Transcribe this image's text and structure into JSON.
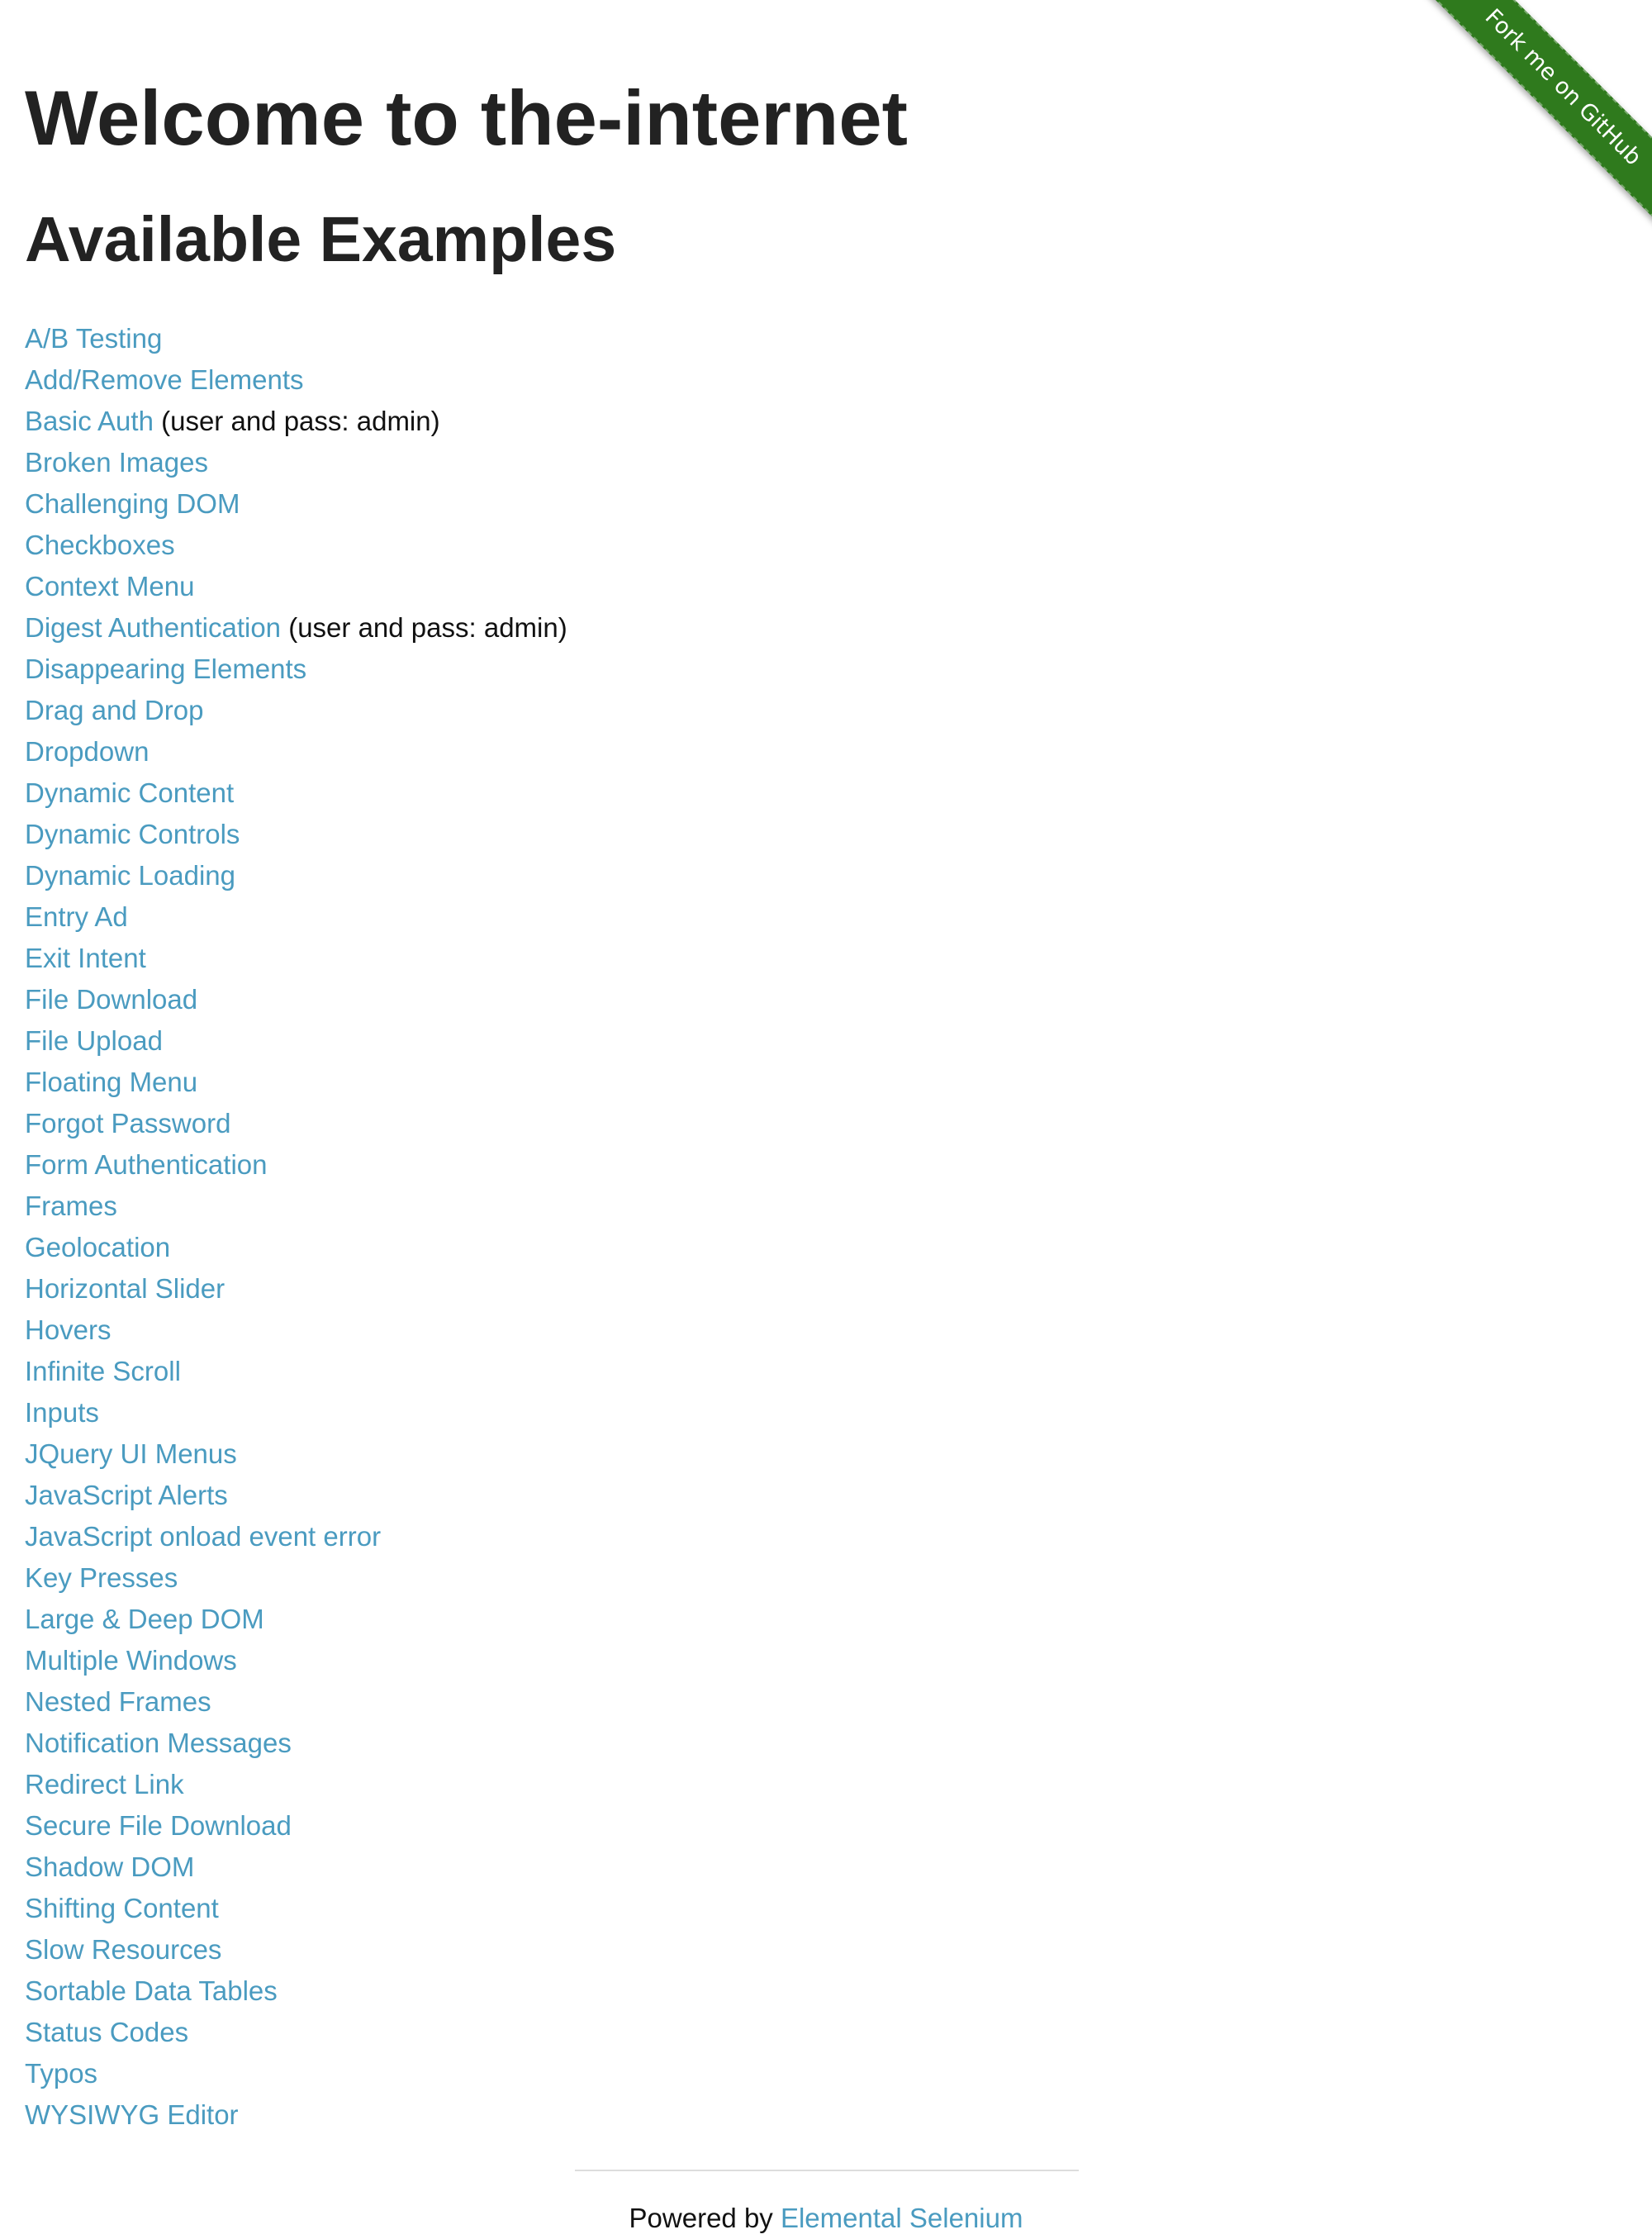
{
  "header": {
    "title": "Welcome to the-internet",
    "subtitle": "Available Examples"
  },
  "ribbon": {
    "label": "Fork me on GitHub",
    "color": "#2f7a1d"
  },
  "colors": {
    "link": "#4a9bc0",
    "heading": "#222222"
  },
  "examples": [
    {
      "label": "A/B Testing"
    },
    {
      "label": "Add/Remove Elements"
    },
    {
      "label": "Basic Auth",
      "note": "(user and pass: admin)"
    },
    {
      "label": "Broken Images"
    },
    {
      "label": "Challenging DOM"
    },
    {
      "label": "Checkboxes"
    },
    {
      "label": "Context Menu"
    },
    {
      "label": "Digest Authentication",
      "note": "(user and pass: admin)"
    },
    {
      "label": "Disappearing Elements"
    },
    {
      "label": "Drag and Drop"
    },
    {
      "label": "Dropdown"
    },
    {
      "label": "Dynamic Content"
    },
    {
      "label": "Dynamic Controls"
    },
    {
      "label": "Dynamic Loading"
    },
    {
      "label": "Entry Ad"
    },
    {
      "label": "Exit Intent"
    },
    {
      "label": "File Download"
    },
    {
      "label": "File Upload"
    },
    {
      "label": "Floating Menu"
    },
    {
      "label": "Forgot Password"
    },
    {
      "label": "Form Authentication"
    },
    {
      "label": "Frames"
    },
    {
      "label": "Geolocation"
    },
    {
      "label": "Horizontal Slider"
    },
    {
      "label": "Hovers"
    },
    {
      "label": "Infinite Scroll"
    },
    {
      "label": "Inputs"
    },
    {
      "label": "JQuery UI Menus"
    },
    {
      "label": "JavaScript Alerts"
    },
    {
      "label": "JavaScript onload event error"
    },
    {
      "label": "Key Presses"
    },
    {
      "label": "Large & Deep DOM"
    },
    {
      "label": "Multiple Windows"
    },
    {
      "label": "Nested Frames"
    },
    {
      "label": "Notification Messages"
    },
    {
      "label": "Redirect Link"
    },
    {
      "label": "Secure File Download"
    },
    {
      "label": "Shadow DOM"
    },
    {
      "label": "Shifting Content"
    },
    {
      "label": "Slow Resources"
    },
    {
      "label": "Sortable Data Tables"
    },
    {
      "label": "Status Codes"
    },
    {
      "label": "Typos"
    },
    {
      "label": "WYSIWYG Editor"
    }
  ],
  "footer": {
    "prefix": "Powered by",
    "link_label": "Elemental Selenium"
  }
}
